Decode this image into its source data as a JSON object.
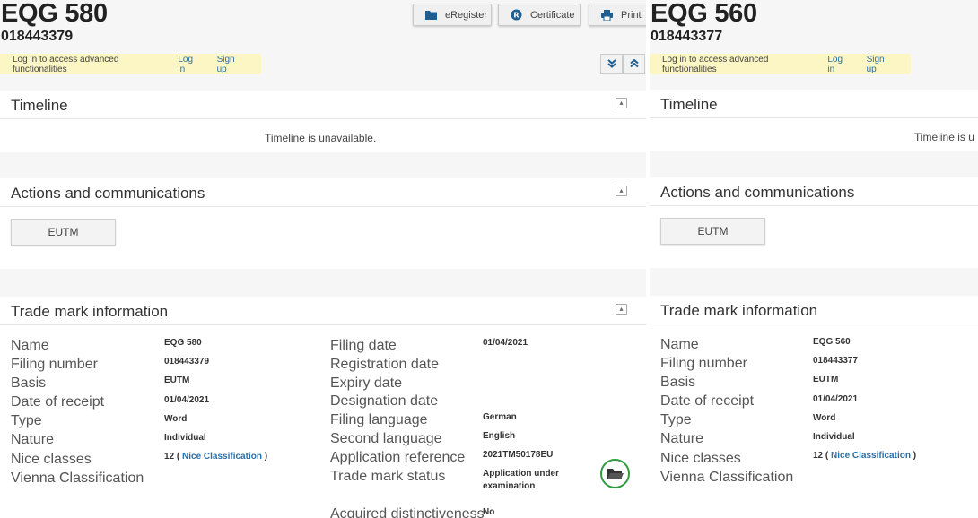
{
  "toolbar": {
    "eregister": "eRegister",
    "certificate": "Certificate",
    "print": "Print",
    "eregister_icon": "folder-icon",
    "certificate_icon": "registered-icon",
    "print_icon": "printer-icon"
  },
  "login": {
    "message": "Log in to access advanced functionalities",
    "login_link": "Log in",
    "signup_link": "Sign up"
  },
  "sections": {
    "timeline": "Timeline",
    "timeline_empty": "Timeline is unavailable.",
    "actions": "Actions and communications",
    "actions_button": "EUTM",
    "tm_info": "Trade mark information"
  },
  "labels": {
    "name": "Name",
    "filing_number": "Filing number",
    "basis": "Basis",
    "date_of_receipt": "Date of receipt",
    "type": "Type",
    "nature": "Nature",
    "nice_classes": "Nice classes",
    "vienna": "Vienna Classification",
    "filing_date": "Filing date",
    "registration_date": "Registration date",
    "expiry_date": "Expiry date",
    "designation_date": "Designation date",
    "filing_language": "Filing language",
    "second_language": "Second language",
    "application_reference": "Application reference",
    "tm_status": "Trade mark status",
    "acquired_distinctiveness": "Acquired distinctiveness"
  },
  "left": {
    "title": "EQG 580",
    "number": "018443379",
    "name": "EQG 580",
    "filing_number": "018443379",
    "basis": "EUTM",
    "date_of_receipt": "01/04/2021",
    "type": "Word",
    "nature": "Individual",
    "nice_count": "12 (",
    "nice_link": "Nice Classification",
    "nice_close": ")",
    "filing_date": "01/04/2021",
    "filing_language": "German",
    "second_language": "English",
    "application_reference": "2021TM50178EU",
    "status_line1": "Application under",
    "status_line2": "examination",
    "acquired_distinctiveness": "No"
  },
  "right": {
    "title": "EQG 560",
    "number": "018443377",
    "timeline_empty": "Timeline is u",
    "name": "EQG 560",
    "filing_number": "018443377",
    "basis": "EUTM",
    "date_of_receipt": "01/04/2021",
    "type": "Word",
    "nature": "Individual",
    "nice_count": "12 (",
    "nice_link": "Nice Classification",
    "nice_close": ")"
  },
  "colors": {
    "link": "#2c6fa6",
    "login_bg": "#fbf6c3",
    "status_ring": "#2e9b3f"
  }
}
